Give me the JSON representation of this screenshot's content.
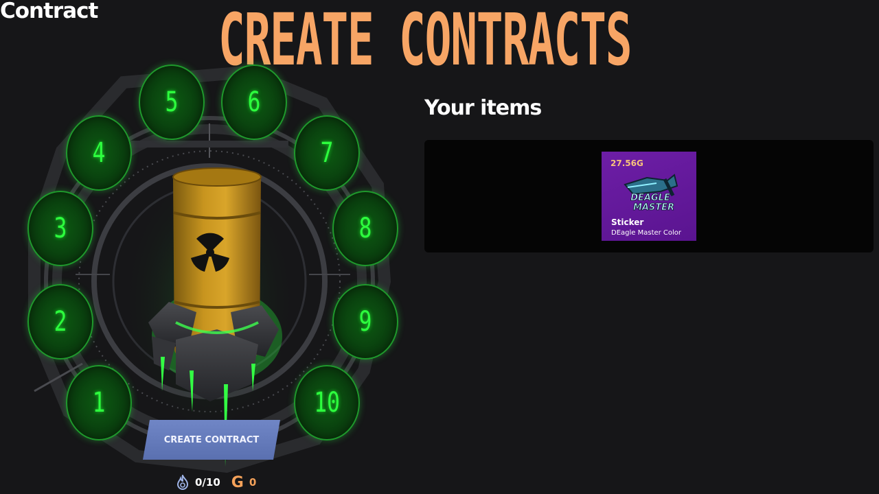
{
  "header": {
    "page_title": "Contract",
    "banner": "CREATE CONTRACTS"
  },
  "contract": {
    "slots": [
      "1",
      "2",
      "3",
      "4",
      "5",
      "6",
      "7",
      "8",
      "9",
      "10"
    ],
    "create_button": "CREATE CONTRACT",
    "count": "0/10",
    "gold_symbol": "G",
    "gold_value": "0"
  },
  "inventory": {
    "heading": "Your items",
    "items": [
      {
        "price": "27.56G",
        "type": "Sticker",
        "name": "DEagle Master Color",
        "art_text": [
          "DEAGLE",
          "MASTER"
        ]
      }
    ]
  },
  "colors": {
    "background": "#161618",
    "banner": "#f7a565",
    "slot_green": "#2dff3e",
    "button": "#6a80c0",
    "item_card": "#6d1ea6",
    "price": "#f7c27c"
  }
}
